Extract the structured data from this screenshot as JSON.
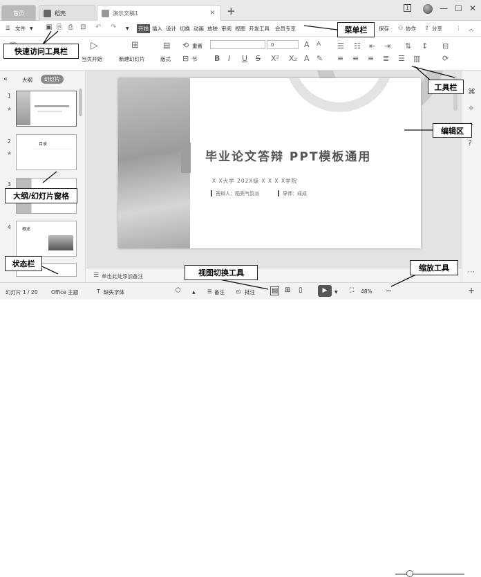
{
  "tabs": {
    "home": "首页",
    "docer": "稻壳",
    "doc": "演示文稿1",
    "new": "+"
  },
  "window": {
    "page_badge": "1",
    "minimize": "—",
    "maximize": "☐",
    "close": "✕"
  },
  "menu": {
    "file": "文件",
    "items": [
      "开始",
      "插入",
      "设计",
      "切换",
      "动画",
      "放映",
      "审阅",
      "视图",
      "开发工具",
      "会员专享"
    ],
    "right": [
      "保存",
      "协作",
      "分享"
    ]
  },
  "toolbar": {
    "play_current": "当页开始",
    "new_slide": "新建幻灯片",
    "layout": "版式",
    "reset": "重置",
    "section": "节",
    "font_size": "0"
  },
  "left_panel": {
    "outline_tab": "大纲",
    "slides_tab": "幻灯片",
    "slide_numbers": [
      "1",
      "2",
      "3",
      "4"
    ],
    "thumb_texts": [
      "目录",
      "概述"
    ]
  },
  "slide": {
    "title": "毕业论文答辩 PPT模板通用",
    "subtitle": "X X大学  202X级  X X X X学院",
    "presenter": "答辩人：稻壳气氛派",
    "advisor": "导师：成成"
  },
  "notes_placeholder": "单击此处添加备注",
  "status": {
    "slide_info": "幻灯片 1 / 20",
    "theme": "Office 主题",
    "missing_font": "缺失字体",
    "notes": "备注",
    "comments": "批注",
    "zoom": "48%"
  },
  "callouts": {
    "menu_bar": "菜单栏",
    "quick_access": "快速访问工具栏",
    "toolbar": "工具栏",
    "edit_area": "编辑区",
    "outline_pane": "大纲/幻灯片窗格",
    "status_bar": "状态栏",
    "view_switch": "视图切换工具",
    "zoom_tool": "缩放工具"
  }
}
